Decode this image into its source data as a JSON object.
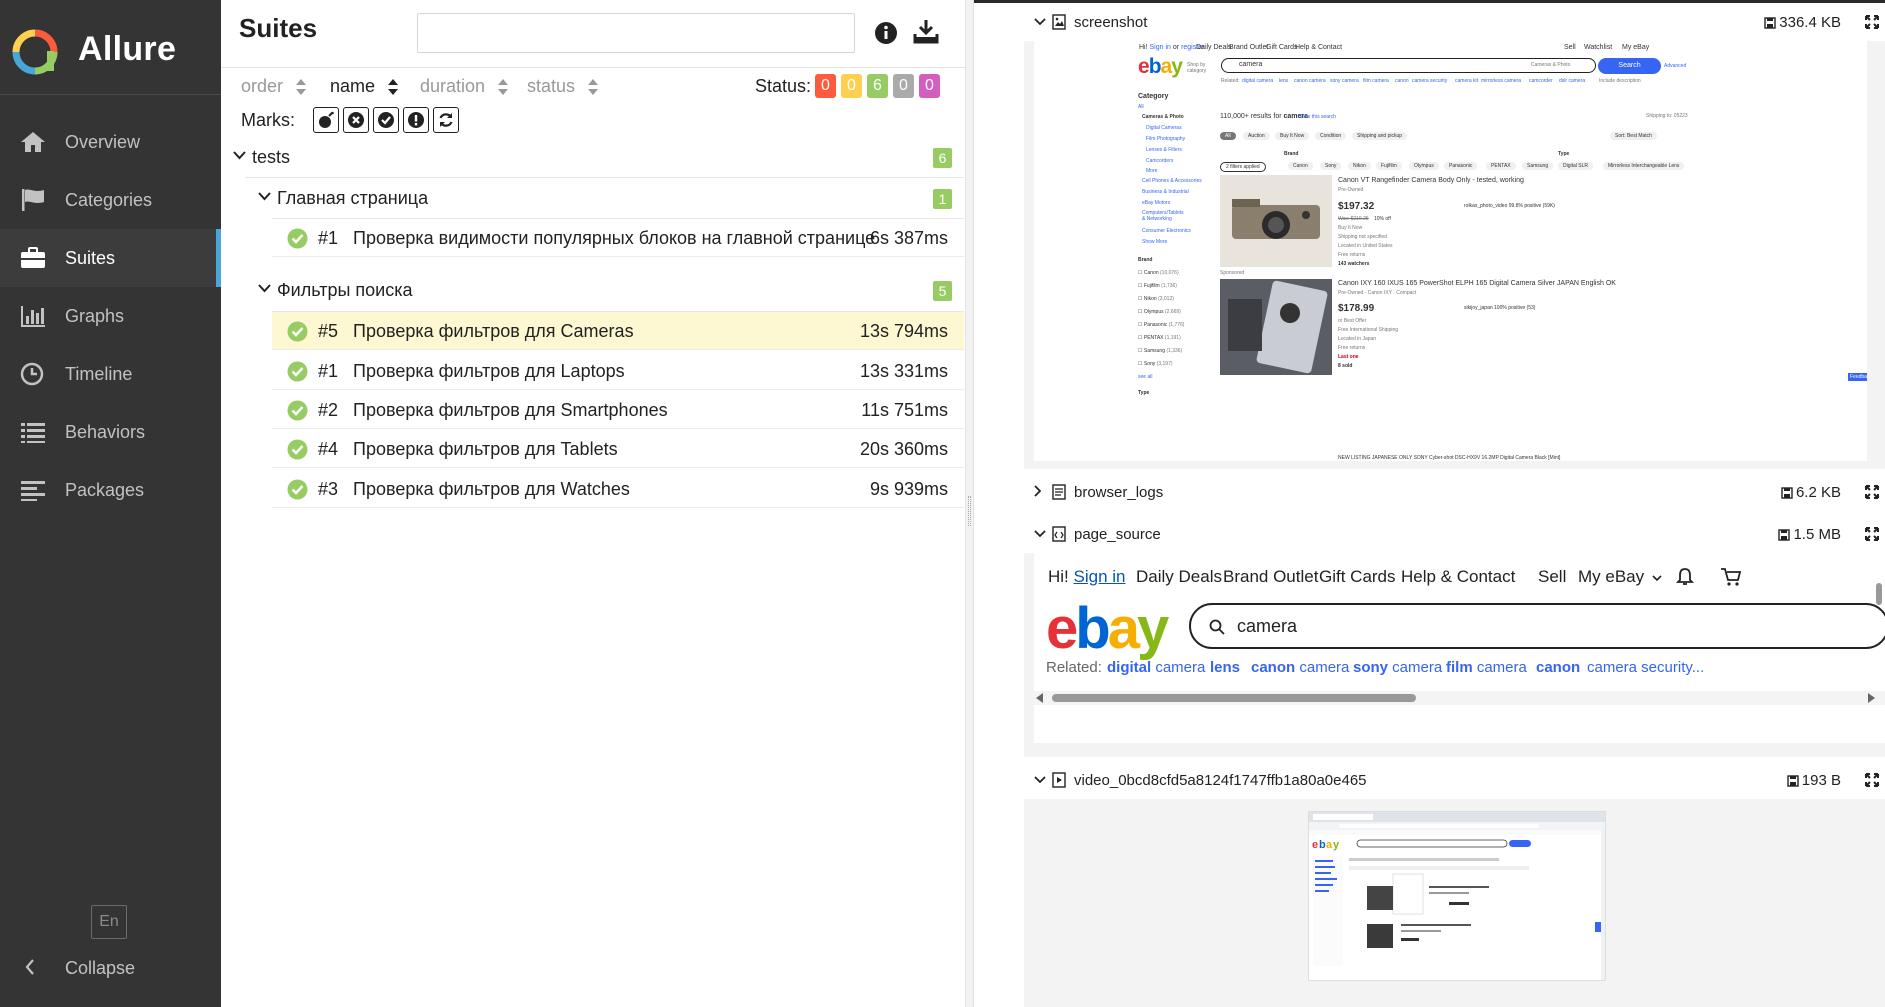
{
  "sidebar": {
    "app_name": "Allure",
    "nav": [
      {
        "label": "Overview",
        "icon": "home-icon"
      },
      {
        "label": "Categories",
        "icon": "flag-icon"
      },
      {
        "label": "Suites",
        "icon": "briefcase-icon"
      },
      {
        "label": "Graphs",
        "icon": "bar-chart-icon"
      },
      {
        "label": "Timeline",
        "icon": "clock-icon"
      },
      {
        "label": "Behaviors",
        "icon": "list-icon"
      },
      {
        "label": "Packages",
        "icon": "align-left-icon"
      }
    ],
    "active": "Suites",
    "language": "En",
    "collapse_label": "Collapse"
  },
  "suites": {
    "title": "Suites",
    "search_value": "",
    "sort": {
      "order_label": "order",
      "name_label": "name",
      "duration_label": "duration",
      "status_label": "status",
      "active": "name"
    },
    "status_label": "Status:",
    "status_counts": [
      {
        "value": "0",
        "color": "#fd5a3e"
      },
      {
        "value": "0",
        "color": "#ffd050"
      },
      {
        "value": "6",
        "color": "#97cc64"
      },
      {
        "value": "0",
        "color": "#aaaaaa"
      },
      {
        "value": "0",
        "color": "#d35ebe"
      }
    ],
    "marks_label": "Marks:",
    "marks": [
      "bomb-icon",
      "times-circle-icon",
      "check-circle-icon",
      "exclamation-circle-icon",
      "refresh-icon"
    ],
    "root": {
      "name": "tests",
      "count": "6"
    },
    "groups": [
      {
        "name": "Главная страница",
        "count": "1",
        "tests": [
          {
            "num": "#1",
            "name": "Проверка видимости популярных блоков на главной странице",
            "duration": "6s 387ms",
            "status": "passed"
          }
        ]
      },
      {
        "name": "Фильтры поиска",
        "count": "5",
        "tests": [
          {
            "num": "#5",
            "name": "Проверка фильтров для Cameras",
            "duration": "13s 794ms",
            "status": "passed",
            "selected": true
          },
          {
            "num": "#1",
            "name": "Проверка фильтров для Laptops",
            "duration": "13s 331ms",
            "status": "passed"
          },
          {
            "num": "#2",
            "name": "Проверка фильтров для Smartphones",
            "duration": "11s 751ms",
            "status": "passed"
          },
          {
            "num": "#4",
            "name": "Проверка фильтров для Tablets",
            "duration": "20s 360ms",
            "status": "passed"
          },
          {
            "num": "#3",
            "name": "Проверка фильтров для Watches",
            "duration": "9s 939ms",
            "status": "passed"
          }
        ]
      }
    ]
  },
  "attachments": [
    {
      "name": "screenshot",
      "size": "336.4 KB",
      "expanded": true
    },
    {
      "name": "browser_logs",
      "size": "6.2 KB",
      "expanded": false
    },
    {
      "name": "page_source",
      "size": "1.5 MB",
      "expanded": true
    },
    {
      "name": "video_0bcd8cfd5a8124f1747ffb1a80a0e465",
      "size": "193 B",
      "expanded": true
    }
  ],
  "screenshot": {
    "top_links": [
      "Hi!",
      "Sign in",
      "or",
      "register",
      "Daily Deals",
      "Brand Outlet",
      "Gift Cards",
      "Help & Contact"
    ],
    "right_links": [
      "Sell",
      "Watchlist",
      "My eBay"
    ],
    "logo": "ebay",
    "shop_by": "Shop by category",
    "search_value": "camera",
    "category_select": "Cameras & Photo",
    "search_btn": "Search",
    "advanced": "Advanced",
    "related_label": "Related:",
    "related": [
      "digital camera",
      "lens",
      "canon camera",
      "sony camera",
      "film camera",
      "canon",
      "camera security",
      "camera kit",
      "mirrorless camera",
      "camcorder",
      "dslr camera"
    ],
    "include_desc": "Include description",
    "results": "110,000+ results for",
    "results_term": "camera",
    "save_search": "Save this search",
    "shipping": "Shipping to: 05223",
    "category_title": "Category",
    "categories": [
      "All",
      "Cameras & Photo",
      "Digital Cameras",
      "Film Photography",
      "Lenses & Filters",
      "Camcorders",
      "More",
      "Cell Phones & Accessories",
      "Business & Industrial",
      "eBay Motors",
      "Computers/Tablets & Networking",
      "Consumer Electronics",
      "Show More"
    ],
    "filter_tabs": [
      "All",
      "Auction",
      "Buy It Now",
      "Condition",
      "Shipping and pickup"
    ],
    "sort_label": "Sort: Best Match",
    "brand_title": "Brand",
    "brand_chips": [
      "2 filters applied",
      "Canon",
      "Sony",
      "Nikon",
      "Fujifilm",
      "Olympus",
      "Panasonic",
      "PENTAX",
      "Samsung"
    ],
    "type_title": "Type",
    "type_chips": [
      "Digital SLR",
      "Mirrorless Interchangeable Lens"
    ],
    "brand_list": [
      "Canon",
      "Fujifilm",
      "Nikon",
      "Olympus",
      "Panasonic",
      "PENTAX",
      "Samsung",
      "Sony"
    ],
    "brand_counts": [
      "(10,076)",
      "(1,736)",
      "(3,012)",
      "(2,669)",
      "(1,776)",
      "(1,191)",
      "(1,336)",
      "(3,197)"
    ],
    "see_all": "see all",
    "type_label": "Type",
    "items": [
      {
        "title": "Canon VT Rangefinder Camera Body Only - tested, working",
        "condition": "Pre-Owned",
        "price": "$197.32",
        "was": "Was: $219.25",
        "off": "10% off",
        "format": "Buy It Now",
        "shipping": "Shipping not specified",
        "location": "Located in United States",
        "returns": "Free returns",
        "extra": "143 watchers",
        "seller": "rolkas_photo_video 99.8% positive (59K)"
      },
      {
        "title": "Canon IXY 160 IXUS 165 PowerShot ELPH 165 Digital Camera Silver JAPAN English OK",
        "condition": "Pre-Owned · Canon IXY · Compact",
        "price": "$178.99",
        "format": "or Best Offer",
        "shipping": "Free International Shipping",
        "location": "Located in Japan",
        "returns": "Free returns",
        "last_one": "Last one",
        "extra": "8 sold",
        "seller": "sikijoy_japan 100% positive (53)"
      }
    ],
    "sponsored": "Sponsored",
    "new_listing": "NEW LISTING JAPANESE ONLY SONY Cyber-shot DSC-HX9V 16.2MP Digital Camera Black [Mint]",
    "feedback": "Feedback"
  },
  "page_source": {
    "hi": "Hi!",
    "sign_in": "Sign in",
    "nav": [
      "Daily Deals",
      "Brand Outlet",
      "Gift Cards",
      "Help & Contact",
      "Sell",
      "My eBay"
    ],
    "search_value": "camera",
    "related_label": "Related:",
    "related": [
      {
        "bold": "digital",
        "rest": " camera"
      },
      {
        "bold": "lens",
        "rest": ""
      },
      {
        "bold": "canon",
        "rest": " camera"
      },
      {
        "bold": "sony",
        "rest": " camera"
      },
      {
        "bold": "film",
        "rest": " camera"
      },
      {
        "bold": "canon",
        "rest": ""
      },
      {
        "bold": "",
        "rest": "camera security..."
      }
    ]
  },
  "colors": {
    "sidebar_bg": "#343434",
    "accent": "#4aa5d9",
    "passed": "#97cc64",
    "selected_row": "#fdf7d2",
    "ebay_blue": "#3665f3"
  }
}
